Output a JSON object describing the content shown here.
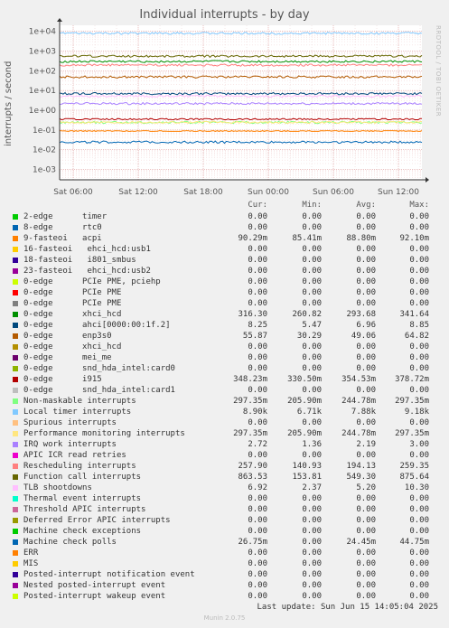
{
  "chart_data": {
    "type": "line",
    "title": "Individual interrupts - by day",
    "ylabel": "interrupts / second",
    "yscale": "log",
    "ylim": [
      0.0003,
      20000
    ],
    "y_ticks": [
      "1e+04",
      "1e+03",
      "1e+02",
      "1e+01",
      "1e+00",
      "1e-01",
      "1e-02",
      "1e-03"
    ],
    "x_ticks": [
      "Sat 06:00",
      "Sat 12:00",
      "Sat 18:00",
      "Sun 00:00",
      "Sun 06:00",
      "Sun 12:00"
    ],
    "watermark": "RRDTOOL / TOBI OETIKER",
    "columns": [
      "Cur:",
      "Min:",
      "Avg:",
      "Max:"
    ],
    "series": [
      {
        "name": "2-edge      timer",
        "color": "#00cc00",
        "cur": "0.00",
        "min": "0.00",
        "avg": "0.00",
        "max": "0.00"
      },
      {
        "name": "8-edge      rtc0",
        "color": "#0066b3",
        "cur": "0.00",
        "min": "0.00",
        "avg": "0.00",
        "max": "0.00"
      },
      {
        "name": "9-fasteoi   acpi",
        "color": "#ff8000",
        "cur": "90.29m",
        "min": "85.41m",
        "avg": "88.80m",
        "max": "92.10m"
      },
      {
        "name": "16-fasteoi   ehci_hcd:usb1",
        "color": "#ffcc00",
        "cur": "0.00",
        "min": "0.00",
        "avg": "0.00",
        "max": "0.00"
      },
      {
        "name": "18-fasteoi   i801_smbus",
        "color": "#330099",
        "cur": "0.00",
        "min": "0.00",
        "avg": "0.00",
        "max": "0.00"
      },
      {
        "name": "23-fasteoi   ehci_hcd:usb2",
        "color": "#990099",
        "cur": "0.00",
        "min": "0.00",
        "avg": "0.00",
        "max": "0.00"
      },
      {
        "name": "0-edge      PCIe PME, pciehp",
        "color": "#ccff00",
        "cur": "0.00",
        "min": "0.00",
        "avg": "0.00",
        "max": "0.00"
      },
      {
        "name": "0-edge      PCIe PME",
        "color": "#ff0000",
        "cur": "0.00",
        "min": "0.00",
        "avg": "0.00",
        "max": "0.00"
      },
      {
        "name": "0-edge      PCIe PME",
        "color": "#808080",
        "cur": "0.00",
        "min": "0.00",
        "avg": "0.00",
        "max": "0.00"
      },
      {
        "name": "0-edge      xhci_hcd",
        "color": "#008f00",
        "cur": "316.30",
        "min": "260.82",
        "avg": "293.68",
        "max": "341.64"
      },
      {
        "name": "0-edge      ahci[0000:00:1f.2]",
        "color": "#00487d",
        "cur": "8.25",
        "min": "5.47",
        "avg": "6.96",
        "max": "8.85"
      },
      {
        "name": "0-edge      enp3s0",
        "color": "#b35a00",
        "cur": "55.87",
        "min": "30.29",
        "avg": "49.06",
        "max": "64.82"
      },
      {
        "name": "0-edge      xhci_hcd",
        "color": "#b38f00",
        "cur": "0.00",
        "min": "0.00",
        "avg": "0.00",
        "max": "0.00"
      },
      {
        "name": "0-edge      mei_me",
        "color": "#6b006b",
        "cur": "0.00",
        "min": "0.00",
        "avg": "0.00",
        "max": "0.00"
      },
      {
        "name": "0-edge      snd_hda_intel:card0",
        "color": "#8fb300",
        "cur": "0.00",
        "min": "0.00",
        "avg": "0.00",
        "max": "0.00"
      },
      {
        "name": "0-edge      i915",
        "color": "#b30000",
        "cur": "348.23m",
        "min": "330.50m",
        "avg": "354.53m",
        "max": "378.72m"
      },
      {
        "name": "0-edge      snd_hda_intel:card1",
        "color": "#bebebe",
        "cur": "0.00",
        "min": "0.00",
        "avg": "0.00",
        "max": "0.00"
      },
      {
        "name": "Non-maskable interrupts",
        "color": "#80ff80",
        "cur": "297.35m",
        "min": "205.90m",
        "avg": "244.78m",
        "max": "297.35m"
      },
      {
        "name": "Local timer interrupts",
        "color": "#80c9ff",
        "cur": "8.90k",
        "min": "6.71k",
        "avg": "7.88k",
        "max": "9.18k"
      },
      {
        "name": "Spurious interrupts",
        "color": "#ffc080",
        "cur": "0.00",
        "min": "0.00",
        "avg": "0.00",
        "max": "0.00"
      },
      {
        "name": "Performance monitoring interrupts",
        "color": "#ffe680",
        "cur": "297.35m",
        "min": "205.90m",
        "avg": "244.78m",
        "max": "297.35m"
      },
      {
        "name": "IRQ work interrupts",
        "color": "#aa80ff",
        "cur": "2.72",
        "min": "1.36",
        "avg": "2.19",
        "max": "3.00"
      },
      {
        "name": "APIC ICR read retries",
        "color": "#ee00cc",
        "cur": "0.00",
        "min": "0.00",
        "avg": "0.00",
        "max": "0.00"
      },
      {
        "name": "Rescheduling interrupts",
        "color": "#ff8080",
        "cur": "257.90",
        "min": "140.93",
        "avg": "194.13",
        "max": "259.35"
      },
      {
        "name": "Function call interrupts",
        "color": "#666600",
        "cur": "863.53",
        "min": "153.81",
        "avg": "549.30",
        "max": "875.64"
      },
      {
        "name": "TLB shootdowns",
        "color": "#ffbfff",
        "cur": "6.92",
        "min": "2.37",
        "avg": "5.20",
        "max": "10.30"
      },
      {
        "name": "Thermal event interrupts",
        "color": "#00ffcc",
        "cur": "0.00",
        "min": "0.00",
        "avg": "0.00",
        "max": "0.00"
      },
      {
        "name": "Threshold APIC interrupts",
        "color": "#cc6699",
        "cur": "0.00",
        "min": "0.00",
        "avg": "0.00",
        "max": "0.00"
      },
      {
        "name": "Deferred Error APIC interrupts",
        "color": "#999900",
        "cur": "0.00",
        "min": "0.00",
        "avg": "0.00",
        "max": "0.00"
      },
      {
        "name": "Machine check exceptions",
        "color": "#00cc00",
        "cur": "0.00",
        "min": "0.00",
        "avg": "0.00",
        "max": "0.00"
      },
      {
        "name": "Machine check polls",
        "color": "#0066b3",
        "cur": "26.75m",
        "min": "0.00",
        "avg": "24.45m",
        "max": "44.75m"
      },
      {
        "name": "ERR",
        "color": "#ff8000",
        "cur": "0.00",
        "min": "0.00",
        "avg": "0.00",
        "max": "0.00"
      },
      {
        "name": "MIS",
        "color": "#ffcc00",
        "cur": "0.00",
        "min": "0.00",
        "avg": "0.00",
        "max": "0.00"
      },
      {
        "name": "Posted-interrupt notification event",
        "color": "#330099",
        "cur": "0.00",
        "min": "0.00",
        "avg": "0.00",
        "max": "0.00"
      },
      {
        "name": "Nested posted-interrupt event",
        "color": "#990099",
        "cur": "0.00",
        "min": "0.00",
        "avg": "0.00",
        "max": "0.00"
      },
      {
        "name": "Posted-interrupt wakeup event",
        "color": "#ccff00",
        "cur": "0.00",
        "min": "0.00",
        "avg": "0.00",
        "max": "0.00"
      }
    ]
  },
  "footer": {
    "last_update": "Last update: Sun Jun 15 14:05:04 2025",
    "munin": "Munin 2.0.75"
  }
}
